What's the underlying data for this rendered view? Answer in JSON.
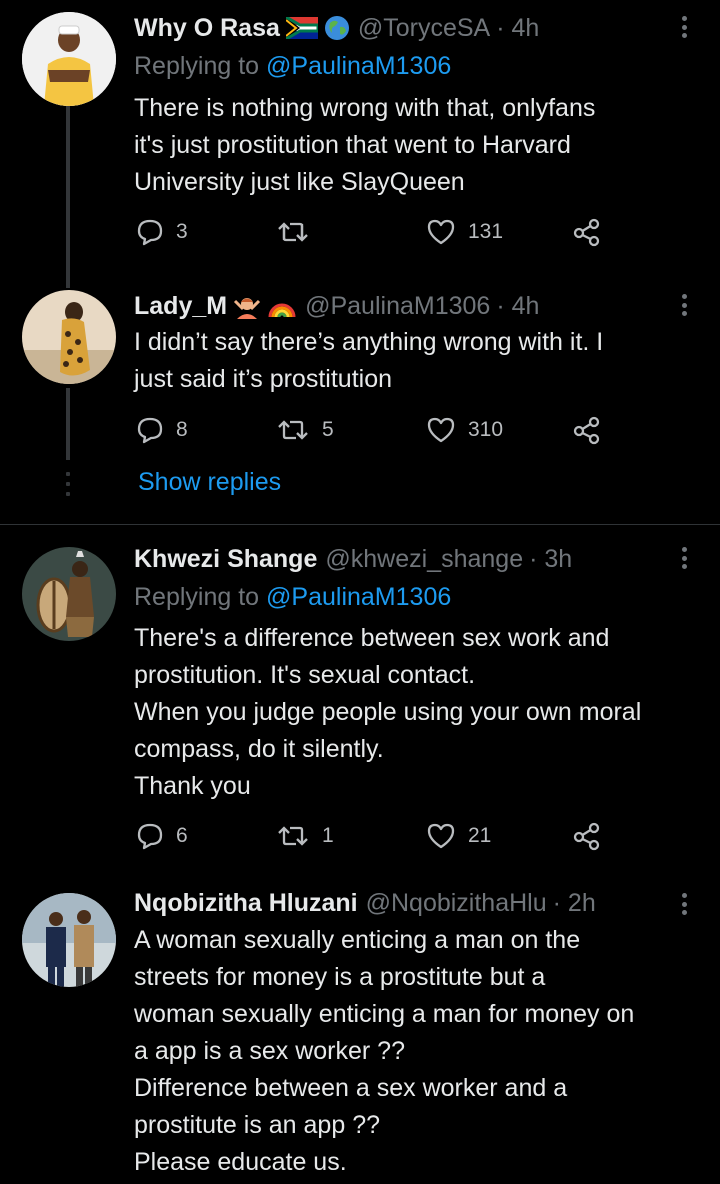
{
  "tweets": [
    {
      "name": "Why O Rasa",
      "handle": "@ToryceSA",
      "time": "· 4h",
      "emojis": [
        "south-africa-flag-icon",
        "globe-icon"
      ],
      "replying_prefix": "Replying to",
      "replying_to": "@PaulinaM1306",
      "lines": [
        "There is nothing wrong with that, onlyfans",
        "it's just prostitution that went to Harvard",
        "University just like SlayQueen"
      ],
      "replies": "3",
      "retweets": "",
      "likes": "131"
    },
    {
      "name": "Lady_M",
      "handle": "@PaulinaM1306",
      "time": "· 4h",
      "emojis": [
        "woman-gesturing-icon",
        "rainbow-icon"
      ],
      "lines": [
        "I didn’t say there’s anything wrong with it. I",
        "just said it’s prostitution"
      ],
      "replies": "8",
      "retweets": "5",
      "likes": "310"
    },
    {
      "name": "Khwezi Shange",
      "handle": "@khwezi_shange",
      "time": "· 3h",
      "replying_prefix": "Replying to",
      "replying_to": "@PaulinaM1306",
      "lines": [
        "There's a difference between sex work and",
        "prostitution. It's sexual contact.",
        "When you judge people using your own moral",
        "compass, do it silently.",
        "Thank you"
      ],
      "replies": "6",
      "retweets": "1",
      "likes": "21"
    },
    {
      "name": "Nqobizitha Hluzani",
      "handle": "@NqobizithaHlu",
      "time": "· 2h",
      "lines": [
        "A woman sexually enticing a man on the",
        "streets for money is a prostitute but a",
        "woman sexually enticing a man for money on",
        "a app is a sex worker ??",
        "Difference between a sex worker and a",
        "prostitute is an app ??",
        "Please educate us."
      ]
    }
  ],
  "show_replies": "Show replies",
  "colors": {
    "background": "#000000",
    "text": "#e7e9ea",
    "secondary": "#71767b",
    "link": "#1d9bf0",
    "thread_line": "#333639"
  }
}
